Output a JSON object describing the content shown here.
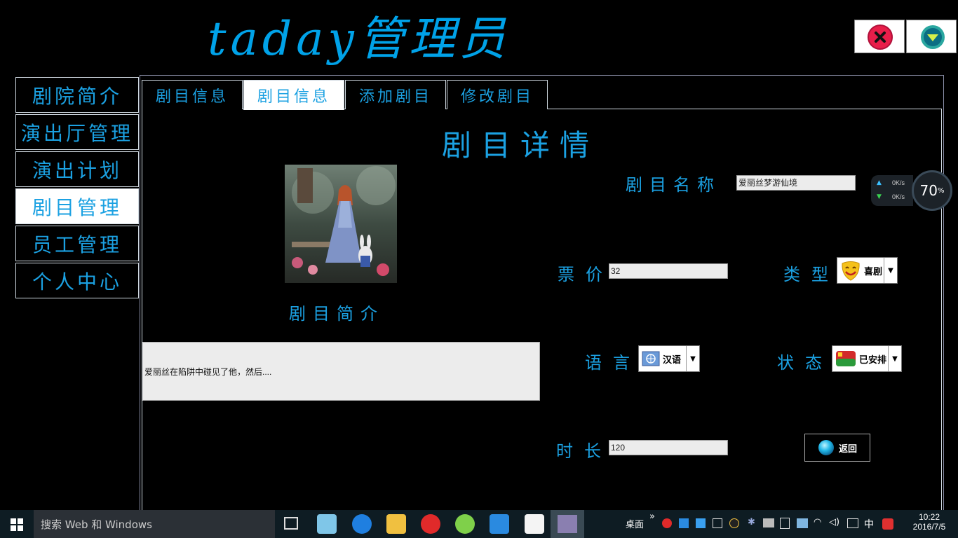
{
  "app": {
    "title": "taday管理员"
  },
  "sidebar": {
    "items": [
      {
        "label": "剧院简介"
      },
      {
        "label": "演出厅管理"
      },
      {
        "label": "演出计划"
      },
      {
        "label": "剧目管理"
      },
      {
        "label": "员工管理"
      },
      {
        "label": "个人中心"
      }
    ],
    "active_index": 3
  },
  "tabs": [
    {
      "label": "剧目信息"
    },
    {
      "label": "剧目信息"
    },
    {
      "label": "添加剧目"
    },
    {
      "label": "修改剧目"
    }
  ],
  "detail": {
    "heading": "剧目详情",
    "name_label": "剧目名称",
    "name_value": "爱丽丝梦游仙境",
    "intro_label": "剧目简介",
    "intro_value": "爱丽丝在陷阱中碰见了他，然后....",
    "price_label": "票价",
    "price_value": "32",
    "type_label": "类型",
    "type_value": "喜剧",
    "language_label": "语言",
    "language_value": "汉语",
    "status_label": "状态",
    "status_value": "已安排",
    "duration_label": "时长",
    "duration_value": "120",
    "back_label": "返回"
  },
  "widget": {
    "up_speed": "0",
    "down_speed": "0",
    "speed_unit": "K/s",
    "percent": "70",
    "percent_sign": "%"
  },
  "taskbar": {
    "search_placeholder": "搜索 Web 和 Windows",
    "desktop_label": "桌面",
    "ime_label": "中",
    "time": "10:22",
    "date": "2016/7/5"
  },
  "colors": {
    "accent": "#1ba1e2",
    "title_accent": "#00a2e8",
    "background": "#000000"
  }
}
